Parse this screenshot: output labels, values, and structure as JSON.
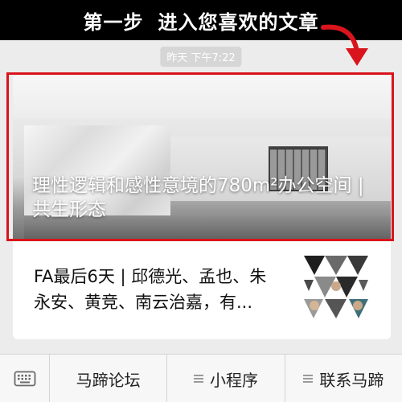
{
  "banner": {
    "step": "第一步",
    "instruction": "进入您喜欢的文章"
  },
  "timestamp": "昨天 下午7:22",
  "articles": [
    {
      "title": "理性逻辑和感性意境的780m²办公空间 | 共生形态"
    },
    {
      "title": "FA最后6天 | 邱德光、孟也、朱永安、黄竞、南云治嘉，有..."
    }
  ],
  "menu": {
    "items": [
      {
        "label": "马蹄论坛",
        "icon": ""
      },
      {
        "label": "小程序",
        "icon": "menu-icon"
      },
      {
        "label": "联系马蹄",
        "icon": "menu-icon"
      }
    ]
  },
  "colors": {
    "highlight": "#d9141c",
    "banner_bg": "#000000",
    "page_bg": "#ececec"
  }
}
